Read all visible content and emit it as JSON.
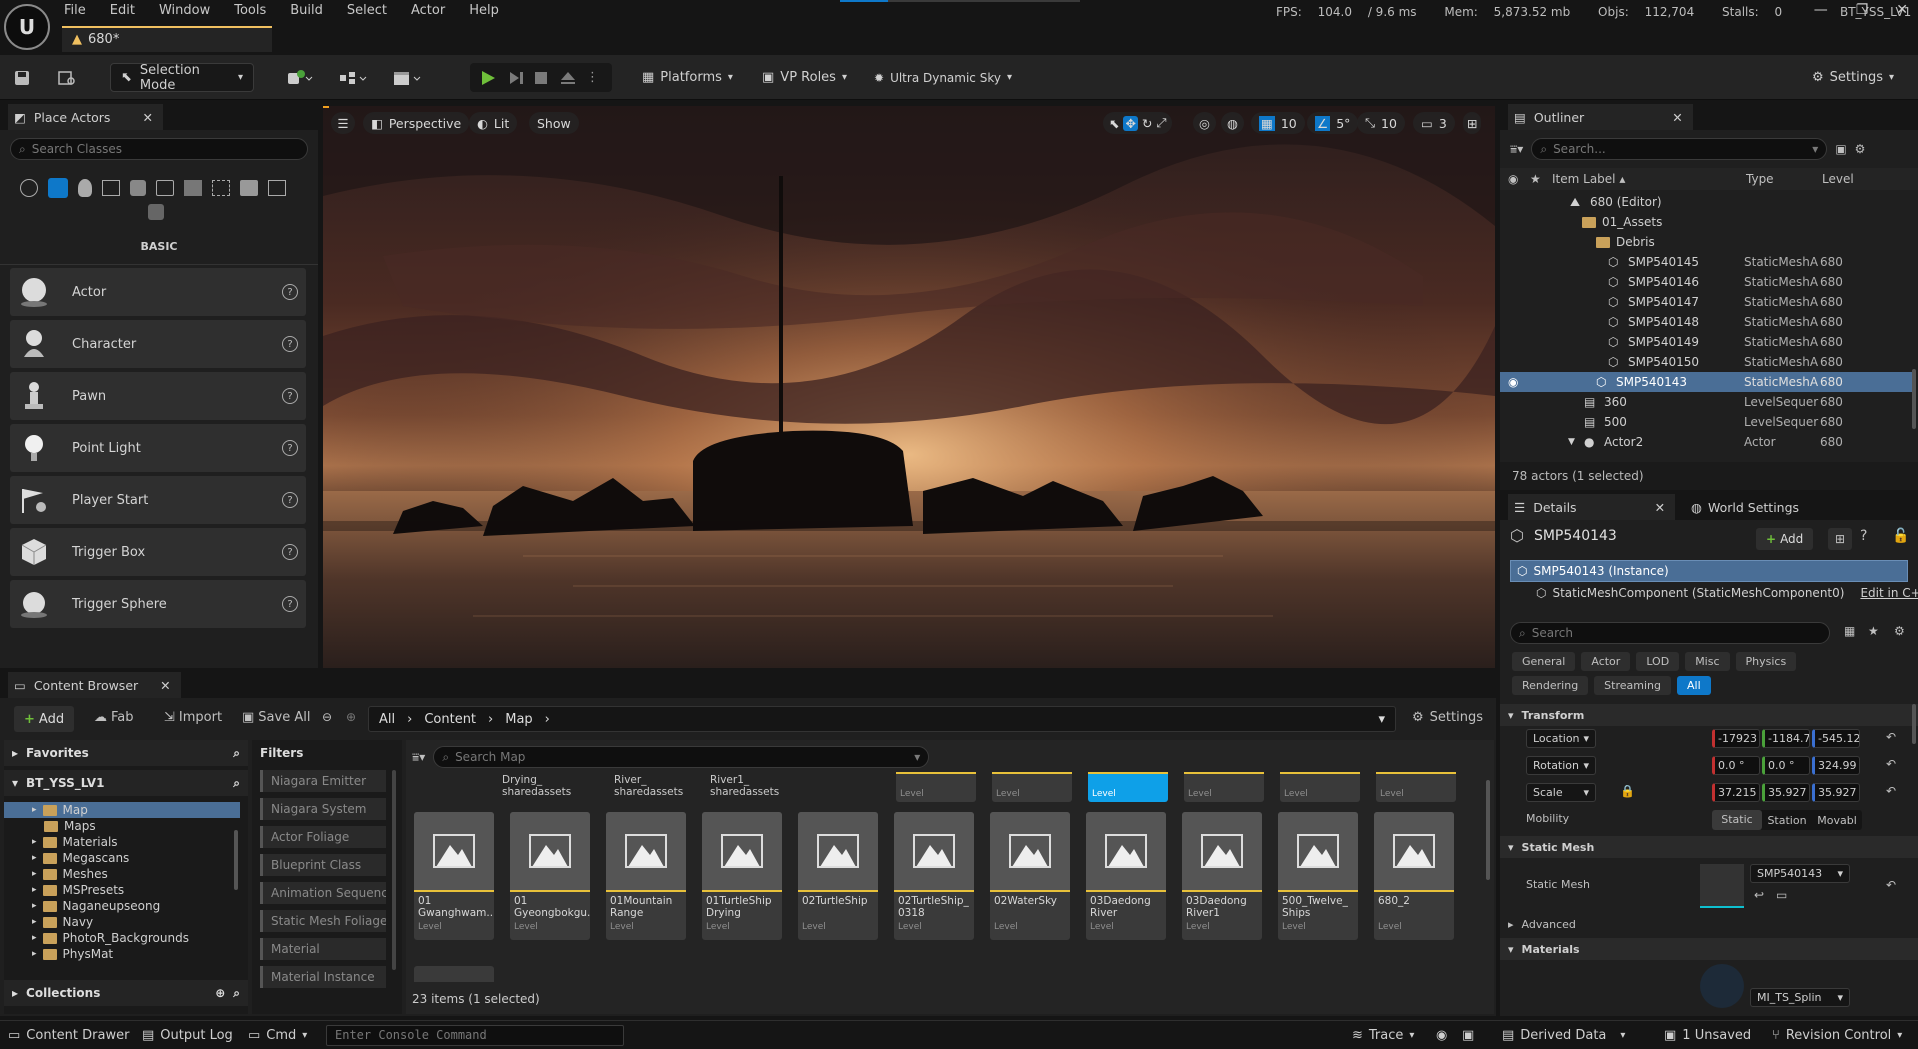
{
  "menubar": {
    "logo_text": "U",
    "items": [
      "File",
      "Edit",
      "Window",
      "Tools",
      "Build",
      "Select",
      "Actor",
      "Help"
    ],
    "tab_title": "680*",
    "stats": {
      "fps_label": "FPS:",
      "fps": "104.0",
      "ms": "/ 9.6 ms",
      "mem_label": "Mem:",
      "mem": "5,873.52 mb",
      "objs_label": "Objs:",
      "objs": "112,704",
      "stalls_label": "Stalls:",
      "stalls": "0"
    },
    "project": "BT_YSS_LV1"
  },
  "toolbar": {
    "selection_mode": "Selection Mode",
    "platforms": "Platforms",
    "vp_roles": "VP Roles",
    "sky": "Ultra Dynamic Sky",
    "settings": "Settings"
  },
  "place_actors": {
    "tab": "Place Actors",
    "search_placeholder": "Search Classes",
    "category": "BASIC",
    "items": [
      "Actor",
      "Character",
      "Pawn",
      "Point Light",
      "Player Start",
      "Trigger Box",
      "Trigger Sphere"
    ],
    "help": "?"
  },
  "viewport": {
    "perspective": "Perspective",
    "lit": "Lit",
    "show": "Show",
    "grid": "10",
    "angle": "5°",
    "scale": "10",
    "cam": "3"
  },
  "outliner": {
    "tab": "Outliner",
    "search_placeholder": "Search...",
    "cols": {
      "label": "Item Label",
      "type": "Type",
      "level": "Level"
    },
    "rows": [
      {
        "label": "680 (Editor)",
        "type": "",
        "level": ""
      },
      {
        "label": "01_Assets",
        "type": "",
        "level": ""
      },
      {
        "label": "Debris",
        "type": "",
        "level": ""
      },
      {
        "label": "SMP540145",
        "type": "StaticMeshA",
        "level": "680"
      },
      {
        "label": "SMP540146",
        "type": "StaticMeshA",
        "level": "680"
      },
      {
        "label": "SMP540147",
        "type": "StaticMeshA",
        "level": "680"
      },
      {
        "label": "SMP540148",
        "type": "StaticMeshA",
        "level": "680"
      },
      {
        "label": "SMP540149",
        "type": "StaticMeshA",
        "level": "680"
      },
      {
        "label": "SMP540150",
        "type": "StaticMeshA",
        "level": "680"
      },
      {
        "label": "SMP540143",
        "type": "StaticMeshA",
        "level": "680"
      },
      {
        "label": "360",
        "type": "LevelSequer",
        "level": "680"
      },
      {
        "label": "500",
        "type": "LevelSequer",
        "level": "680"
      },
      {
        "label": "Actor2",
        "type": "Actor",
        "level": "680"
      }
    ],
    "footer": "78 actors (1 selected)"
  },
  "details": {
    "tab": "Details",
    "tab2": "World Settings",
    "name": "SMP540143",
    "add": "Add",
    "instance": "SMP540143 (Instance)",
    "component": "StaticMeshComponent (StaticMeshComponent0)",
    "edit_cpp": "Edit in C++",
    "search_placeholder": "Search",
    "filters_row1": [
      "General",
      "Actor",
      "LOD",
      "Misc",
      "Physics"
    ],
    "filters_row2": [
      "Rendering",
      "Streaming",
      "All"
    ],
    "transform": "Transform",
    "location": {
      "label": "Location",
      "x": "-17923",
      "y": "-1184.7",
      "z": "-545.12"
    },
    "rotation": {
      "label": "Rotation",
      "x": "0.0 °",
      "y": "0.0 °",
      "z": "324.99"
    },
    "scale": {
      "label": "Scale",
      "x": "37.215",
      "y": "35.927",
      "z": "35.927"
    },
    "mobility": {
      "label": "Mobility",
      "options": [
        "Static",
        "Station",
        "Movabl"
      ]
    },
    "static_mesh_section": "Static Mesh",
    "static_mesh_label": "Static Mesh",
    "static_mesh_value": "SMP540143",
    "advanced": "Advanced",
    "materials": "Materials",
    "material_value": "MI_TS_Splin"
  },
  "content_browser": {
    "tab": "Content Browser",
    "add": "Add",
    "fab": "Fab",
    "import": "Import",
    "save_all": "Save All",
    "path": [
      "All",
      "Content",
      "Map"
    ],
    "settings": "Settings",
    "favorites": "Favorites",
    "root": "BT_YSS_LV1",
    "tree": [
      "Map",
      "Maps",
      "Materials",
      "Megascans",
      "Meshes",
      "MSPresets",
      "Naganeupseong",
      "Navy",
      "PhotoR_Backgrounds",
      "PhysMat"
    ],
    "collections": "Collections",
    "filters_title": "Filters",
    "filters": [
      "Niagara Emitter",
      "Niagara System",
      "Actor Foliage",
      "Blueprint Class",
      "Animation Sequence",
      "Static Mesh Foliage",
      "Material",
      "Material Instance"
    ],
    "search_placeholder": "Search Map",
    "top_tiles": [
      "Drying_ sharedassets",
      "River_ sharedassets",
      "River1_ sharedassets"
    ],
    "level_label": "Level",
    "tiles": [
      "01 Gwanghwam...",
      "01 Gyeongbokgu...",
      "01Mountain Range",
      "01TurtleShip Drying",
      "02TurtleShip",
      "02TurtleShip_ 0318",
      "02WaterSky",
      "03Daedong River",
      "03Daedong River1",
      "500_Twelve_ Ships",
      "680_2"
    ],
    "count": "23 items (1 selected)"
  },
  "statusbar": {
    "content_drawer": "Content Drawer",
    "output_log": "Output Log",
    "cmd": "Cmd",
    "console_placeholder": "Enter Console Command",
    "trace": "Trace",
    "derived_data": "Derived Data",
    "unsaved": "1 Unsaved",
    "revision": "Revision Control"
  },
  "colors": {
    "accent": "#0e78c9",
    "selected_row": "#4a6e96",
    "highlight": "#e8c13a"
  }
}
